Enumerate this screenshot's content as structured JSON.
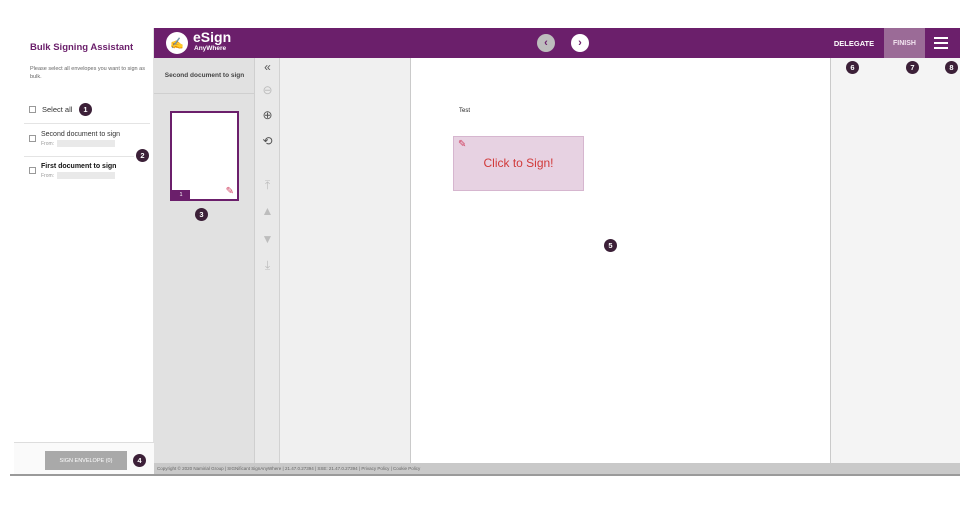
{
  "left_panel": {
    "title": "Bulk Signing Assistant",
    "description": "Please select all envelopes you want to sign as bulk.",
    "select_all_label": "Select all",
    "envelopes": [
      {
        "title": "Second document to sign",
        "from_label": "From:"
      },
      {
        "title": "First document to sign",
        "from_label": "From:"
      }
    ],
    "sign_button_label": "SIGN ENVELOPE (0)"
  },
  "header": {
    "logo_main": "eSign",
    "logo_sub": "AnyWhere",
    "prev_icon": "‹",
    "next_icon": "›",
    "delegate_label": "DELEGATE",
    "finish_label": "FINISH"
  },
  "thumbnails": {
    "panel_title": "Second document to sign",
    "page_number": "1"
  },
  "document": {
    "text": "Test",
    "signature_label": "Click to Sign!"
  },
  "footer": {
    "text": "Copyright © 2020 Namirial Group | SIGNificant SignAnyWhere | 21.47.0.27394 | SSE: 21.47.0.27394 | Privacy Policy | Cookie Policy"
  },
  "badges": [
    "1",
    "2",
    "3",
    "4",
    "5",
    "6",
    "7",
    "8"
  ],
  "colors": {
    "brand_purple": "#6b1f6b",
    "badge_dark": "#3c2038",
    "signature_red": "#d13a3a"
  }
}
